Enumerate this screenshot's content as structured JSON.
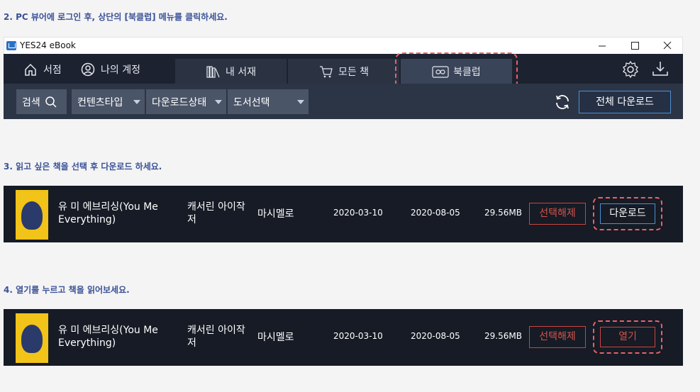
{
  "steps": {
    "step2": "2. PC 뷰어에 로그인 후, 상단의 [북클럽] 메뉴를 클릭하세요.",
    "step3": "3. 읽고 싶은 책을 선택 후 다운로드 하세요.",
    "step4": "4. 열기를 누르고 책을 읽어보세요."
  },
  "window": {
    "title": "YES24 eBook"
  },
  "nav": {
    "store": "서점",
    "account": "나의 계정",
    "tabs": [
      "내 서재",
      "모든 책",
      "북클럽"
    ],
    "active_tab": "북클럽"
  },
  "toolbar": {
    "search": "검색",
    "filters": [
      "컨텐츠타입",
      "다운로드상태",
      "도서선택"
    ],
    "download_all": "전체 다운로드"
  },
  "books": [
    {
      "title": "유 미 에브리싱(You Me Everything)",
      "author": "캐서린 아이작 저",
      "publisher": "마시멜로",
      "date1": "2020-03-10",
      "date2": "2020-08-05",
      "size": "29.56MB",
      "deselect": "선택해제",
      "action": "다운로드"
    },
    {
      "title": "유 미 에브리싱(You Me Everything)",
      "author": "캐서린 아이작 저",
      "publisher": "마시멜로",
      "date1": "2020-03-10",
      "date2": "2020-08-05",
      "size": "29.56MB",
      "deselect": "선택해제",
      "action": "열기"
    }
  ],
  "colors": {
    "highlight": "#e8626b",
    "accent_blue": "#4c8fd4",
    "nav_bg": "#1c2230",
    "step_text": "#3b5296"
  }
}
